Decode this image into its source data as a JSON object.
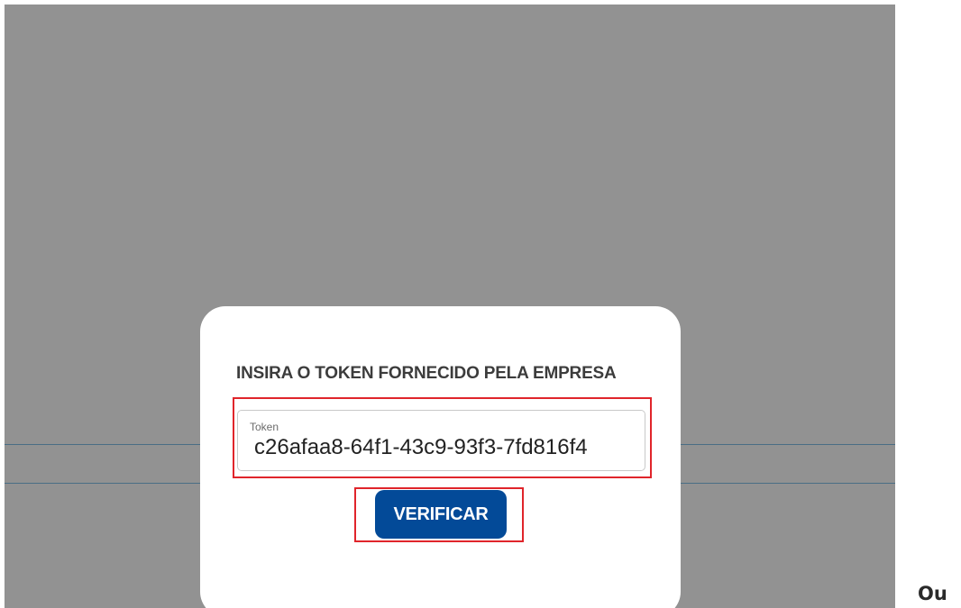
{
  "modal": {
    "title": "INSIRA O TOKEN FORNECIDO PELA EMPRESA",
    "token_field": {
      "label": "Token",
      "value": "c26afaa8-64f1-43c9-93f3-7fd816f4"
    },
    "verify_label": "VERIFICAR"
  },
  "side_text": "Ou",
  "colors": {
    "backdrop": "#929292",
    "button": "#034a98",
    "highlight": "#e0252b"
  }
}
